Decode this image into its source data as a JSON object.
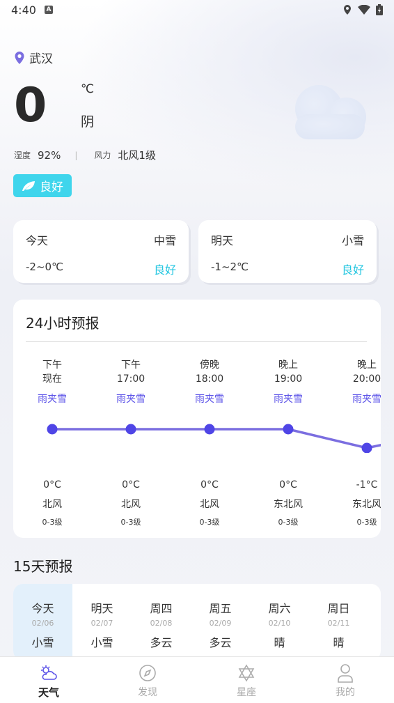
{
  "status": {
    "time": "4:40"
  },
  "location": "武汉",
  "current": {
    "temp": "0",
    "unit": "℃",
    "condition": "阴",
    "humidity_label": "湿度",
    "humidity": "92%",
    "separator": "|",
    "wind_label": "风力",
    "wind": "北风1级",
    "aqi": "良好"
  },
  "days": [
    {
      "label": "今天",
      "weather": "中雪",
      "range": "-2~0℃",
      "aqi": "良好"
    },
    {
      "label": "明天",
      "weather": "小雪",
      "range": "-1~2℃",
      "aqi": "良好"
    }
  ],
  "hourly": {
    "title": "24小时预报",
    "items": [
      {
        "period": "下午",
        "time": "现在",
        "weather": "雨夹雪",
        "temp": "0°C",
        "wind": "北风",
        "level": "0-3级"
      },
      {
        "period": "下午",
        "time": "17:00",
        "weather": "雨夹雪",
        "temp": "0°C",
        "wind": "北风",
        "level": "0-3级"
      },
      {
        "period": "傍晚",
        "time": "18:00",
        "weather": "雨夹雪",
        "temp": "0°C",
        "wind": "北风",
        "level": "0-3级"
      },
      {
        "period": "晚上",
        "time": "19:00",
        "weather": "雨夹雪",
        "temp": "0°C",
        "wind": "东北风",
        "level": "0-3级"
      },
      {
        "period": "晚上",
        "time": "20:00",
        "weather": "雨夹雪",
        "temp": "-1°C",
        "wind": "东北风",
        "level": "0-3级"
      }
    ],
    "temps": [
      0,
      0,
      0,
      0,
      -1
    ]
  },
  "forecast15": {
    "title": "15天预报",
    "items": [
      {
        "day": "今天",
        "date": "02/06",
        "cond": "小雪"
      },
      {
        "day": "明天",
        "date": "02/07",
        "cond": "小雪"
      },
      {
        "day": "周四",
        "date": "02/08",
        "cond": "多云"
      },
      {
        "day": "周五",
        "date": "02/09",
        "cond": "多云"
      },
      {
        "day": "周六",
        "date": "02/10",
        "cond": "晴"
      },
      {
        "day": "周日",
        "date": "02/11",
        "cond": "晴"
      }
    ]
  },
  "tabs": [
    {
      "label": "天气",
      "icon": "weather-icon"
    },
    {
      "label": "发现",
      "icon": "compass-icon"
    },
    {
      "label": "星座",
      "icon": "star-of-david-icon"
    },
    {
      "label": "我的",
      "icon": "user-icon"
    }
  ],
  "colors": {
    "accent": "#3fd5ec",
    "line": "#7b6ee0",
    "point": "#4f45e6",
    "link": "#5b52e8"
  }
}
